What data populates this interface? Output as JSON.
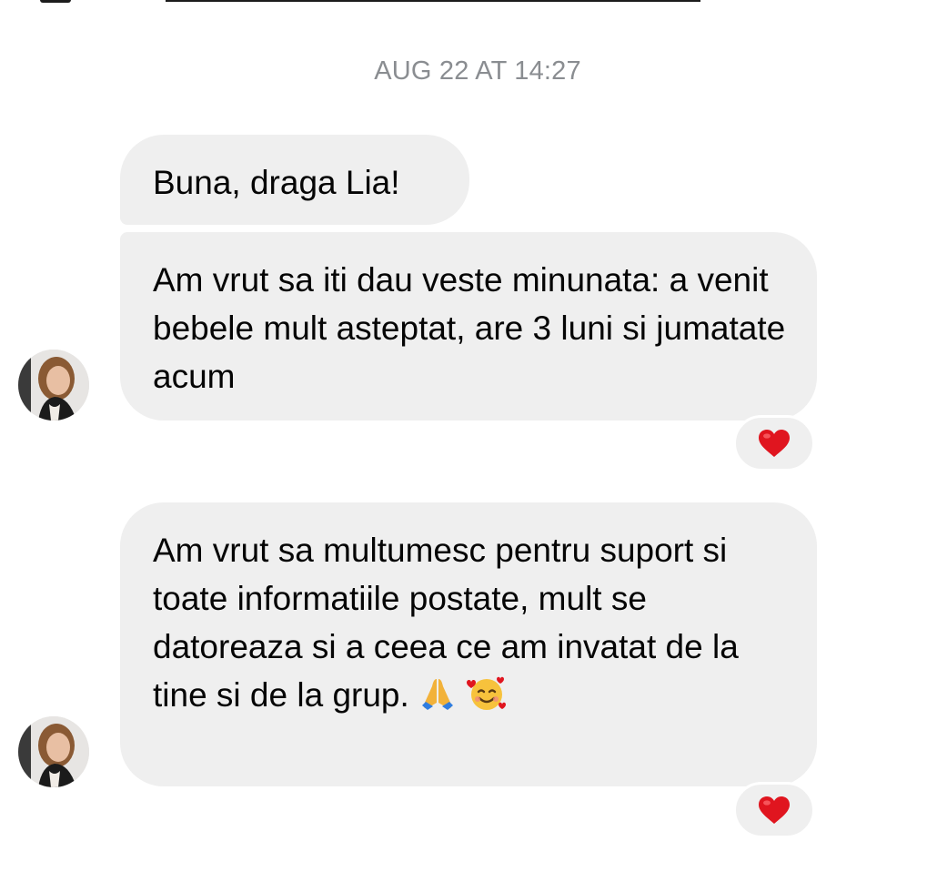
{
  "timestamp": "AUG 22 AT 14:27",
  "messages": [
    {
      "text": "Buna, draga Lia!"
    },
    {
      "text": "Am vrut sa iti dau veste minunata: a venit bebele mult asteptat, are 3 luni si jumatate acum",
      "reaction": "red-heart"
    },
    {
      "text": "Am vrut sa multumesc pentru suport si toate informatiile postate, mult se datoreaza si a ceea ce am invatat de la tine si de la grup.",
      "emojis": [
        "folded-hands",
        "smiling-face-with-hearts"
      ],
      "reaction": "red-heart"
    }
  ],
  "colors": {
    "bubble": "#efefef",
    "timestamp": "#8a8d91",
    "heart": "#e0151f"
  }
}
